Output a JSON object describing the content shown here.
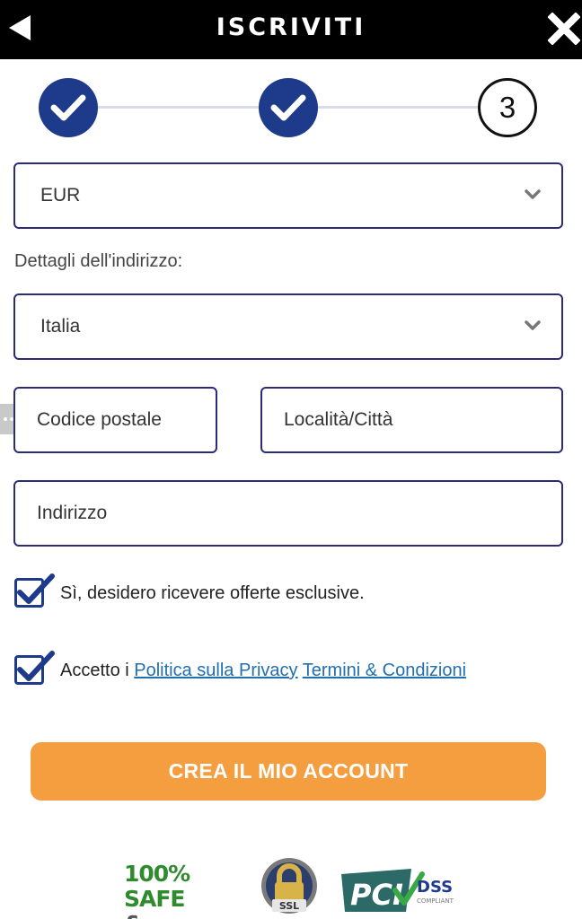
{
  "header": {
    "title": "ISCRIVITI",
    "back_icon": "back-arrow-icon",
    "close_icon": "close-icon"
  },
  "stepper": {
    "steps": [
      {
        "state": "done",
        "icon": "checkmark-icon"
      },
      {
        "state": "done",
        "icon": "checkmark-icon"
      },
      {
        "state": "current",
        "number": "3"
      }
    ],
    "accent": "#1e3a8a"
  },
  "form": {
    "currency": {
      "value": "EUR",
      "icon": "chevron-down-icon"
    },
    "address_label": "Dettagli dell'indirizzo:",
    "country": {
      "value": "Italia",
      "icon": "chevron-down-icon"
    },
    "postal_code": {
      "placeholder": "Codice postale"
    },
    "city": {
      "placeholder": "Località/Città"
    },
    "address": {
      "placeholder": "Indirizzo"
    },
    "offers_checkbox": {
      "checked": true,
      "label": "Sì, desidero ricevere offerte esclusive."
    },
    "terms_checkbox": {
      "checked": true,
      "label_prefix": "Accetto i ",
      "privacy_link": "Politica sulla Privacy",
      "terms_link": "Termini & Condizioni"
    },
    "submit_label": "CREA IL MIO ACCOUNT",
    "submit_color": "#f49e40"
  },
  "trust_badges": {
    "safe_line1": "100% SAFE",
    "safe_line2": "& SECURE",
    "ssl_label": "SSL",
    "pci_label": "PCI",
    "dss_label": "DSS",
    "compliant_label": "COMPLIANT"
  }
}
